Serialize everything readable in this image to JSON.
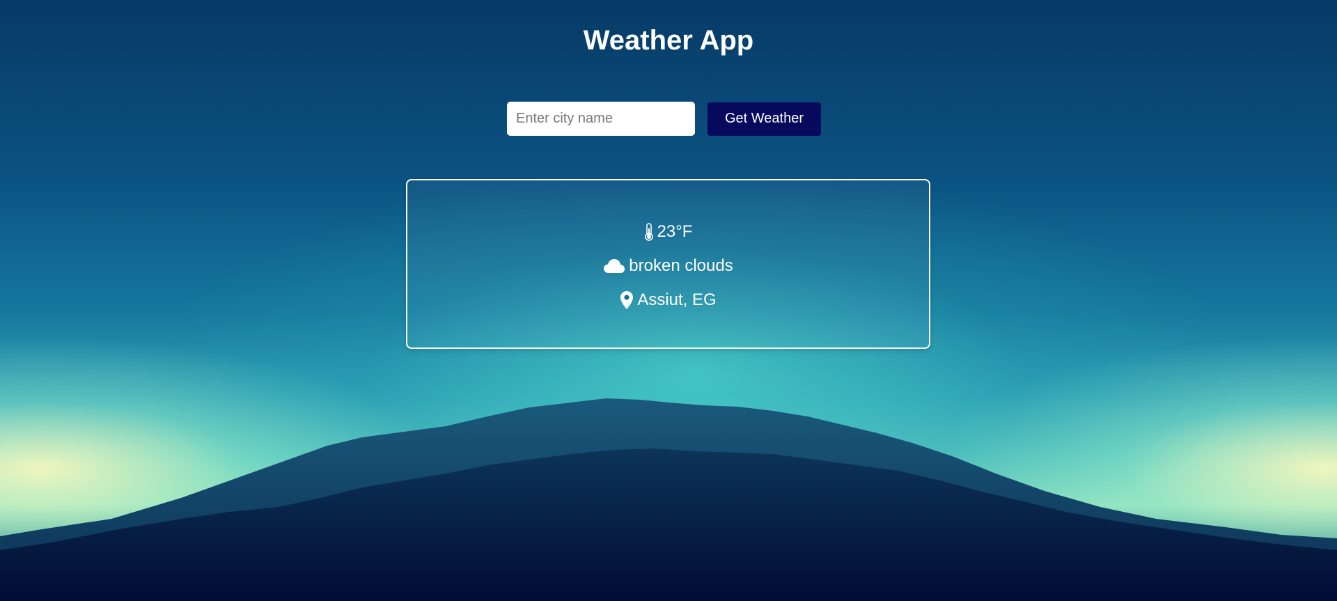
{
  "app": {
    "title": "Weather App"
  },
  "search": {
    "placeholder": "Enter city name",
    "value": "",
    "button_label": "Get Weather"
  },
  "weather": {
    "temperature": "23°F",
    "description": "broken clouds",
    "location": "Assiut, EG",
    "icons": {
      "temperature": "thermometer-icon",
      "description": "cloud-icon",
      "location": "map-pin-icon"
    }
  },
  "colors": {
    "button_background": "#06095c",
    "card_border": "#ffffff",
    "text": "#ffffff"
  }
}
